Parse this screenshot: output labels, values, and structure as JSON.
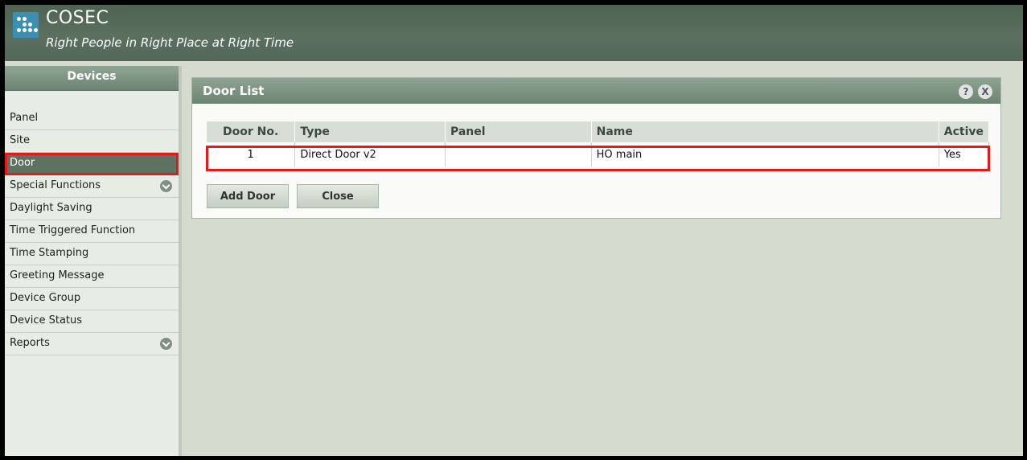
{
  "header": {
    "title": "COSEC",
    "tagline": "Right People in Right Place at Right Time"
  },
  "sidebar": {
    "title": "Devices",
    "items": [
      {
        "label": "Panel"
      },
      {
        "label": "Site"
      },
      {
        "label": "Door"
      },
      {
        "label": "Special Functions"
      },
      {
        "label": "Daylight Saving"
      },
      {
        "label": "Time Triggered Function"
      },
      {
        "label": "Time Stamping"
      },
      {
        "label": "Greeting Message"
      },
      {
        "label": "Device Group"
      },
      {
        "label": "Device Status"
      },
      {
        "label": "Reports"
      }
    ],
    "selected": "Door"
  },
  "panel": {
    "title": "Door List",
    "help_icon": "?",
    "close_icon": "X",
    "columns": [
      "Door No.",
      "Type",
      "Panel",
      "Name",
      "Active"
    ],
    "rows": [
      {
        "door_no": "1",
        "type": "Direct Door v2",
        "panel": "",
        "name": "HO main",
        "active": "Yes"
      }
    ],
    "add_button": "Add Door",
    "close_button": "Close"
  },
  "colors": {
    "highlight": "#e21a1a",
    "header_bg": "#53665a",
    "selected_item": "#5e7262"
  }
}
